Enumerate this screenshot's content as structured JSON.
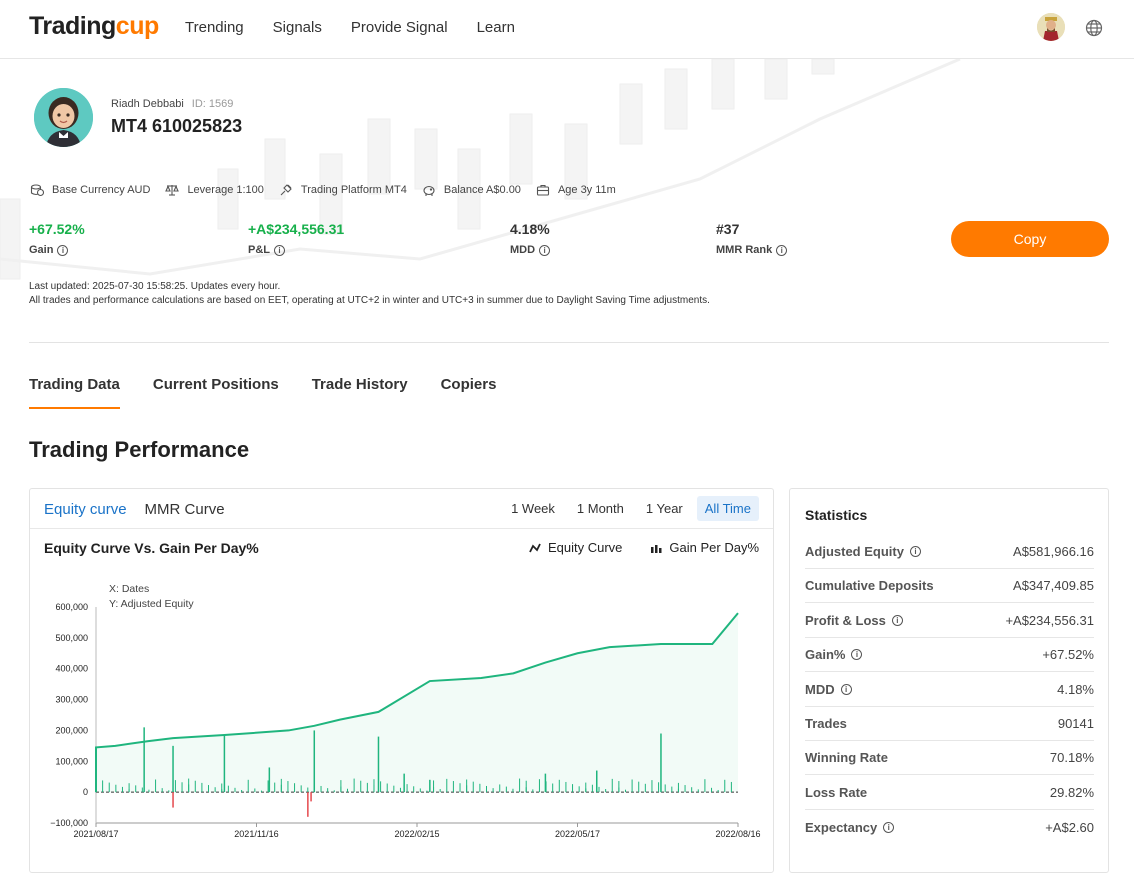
{
  "header": {
    "logo_part1": "Trading",
    "logo_part2": "cup",
    "nav": [
      "Trending",
      "Signals",
      "Provide Signal",
      "Learn"
    ]
  },
  "profile": {
    "name": "Riadh Debbabi",
    "id": "ID: 1569",
    "account": "MT4 610025823"
  },
  "meta": [
    {
      "icon": "currency-icon",
      "text": "Base Currency AUD"
    },
    {
      "icon": "scale-icon",
      "text": "Leverage 1:100"
    },
    {
      "icon": "platform-icon",
      "text": "Trading Platform MT4"
    },
    {
      "icon": "piggy-bank-icon",
      "text": "Balance A$0.00"
    },
    {
      "icon": "briefcase-icon",
      "text": "Age 3y 11m"
    }
  ],
  "kpis": {
    "gain": {
      "value": "+67.52%",
      "label": "Gain"
    },
    "pnl": {
      "value": "+A$234,556.31",
      "label": "P&L"
    },
    "mdd": {
      "value": "4.18%",
      "label": "MDD"
    },
    "rank": {
      "value": "#37",
      "label": "MMR Rank"
    }
  },
  "copy_label": "Copy",
  "notes": {
    "line1": "Last updated: 2025-07-30 15:58:25. Updates every hour.",
    "line2": "All trades and performance calculations are based on EET, operating at UTC+2 in winter and UTC+3 in summer due to Daylight Saving Time adjustments."
  },
  "tabs": [
    "Trading Data",
    "Current Positions",
    "Trade History",
    "Copiers"
  ],
  "section_title": "Trading Performance",
  "chart_card": {
    "tabs": [
      "Equity curve",
      "MMR Curve"
    ],
    "ranges": [
      "1 Week",
      "1 Month",
      "1 Year",
      "All Time"
    ],
    "title": "Equity Curve Vs. Gain Per Day%",
    "legend_equity": "Equity Curve",
    "legend_gain": "Gain Per Day%",
    "axis_note_x": "X: Dates",
    "axis_note_y": "Y: Adjusted Equity"
  },
  "chart_data": {
    "type": "line",
    "title": "Equity Curve Vs. Gain Per Day%",
    "xlabel": "Dates",
    "ylabel": "Adjusted Equity",
    "ylim": [
      -100000,
      600000
    ],
    "yticks": [
      "600,000",
      "500,000",
      "400,000",
      "300,000",
      "200,000",
      "100,000",
      "0",
      "−100,000"
    ],
    "xticks": [
      "2021/08/17",
      "2021/11/16",
      "2022/02/15",
      "2022/05/17",
      "2022/08/16"
    ],
    "series": [
      {
        "name": "Equity Curve",
        "color": "#1fb57e",
        "x": [
          0,
          0.03,
          0.08,
          0.12,
          0.2,
          0.3,
          0.34,
          0.38,
          0.44,
          0.52,
          0.6,
          0.65,
          0.7,
          0.75,
          0.8,
          0.88,
          0.96,
          1.0
        ],
        "values": [
          145000,
          150000,
          165000,
          175000,
          185000,
          200000,
          215000,
          235000,
          260000,
          360000,
          370000,
          385000,
          420000,
          450000,
          470000,
          480000,
          480000,
          580000
        ]
      },
      {
        "name": "Gain Per Day%",
        "color": "#1fb57e",
        "negative_color": "#e5484d",
        "bars": [
          {
            "x": 0.075,
            "v": 210000
          },
          {
            "x": 0.12,
            "v": 150000
          },
          {
            "x": 0.2,
            "v": 185000
          },
          {
            "x": 0.34,
            "v": 200000
          },
          {
            "x": 0.44,
            "v": 180000
          },
          {
            "x": 0.88,
            "v": 190000
          },
          {
            "x": 0.27,
            "v": 80000
          },
          {
            "x": 0.48,
            "v": 60000
          },
          {
            "x": 0.52,
            "v": 40000
          },
          {
            "x": 0.7,
            "v": 60000
          },
          {
            "x": 0.78,
            "v": 70000
          },
          {
            "x": 0.12,
            "v": -50000
          },
          {
            "x": 0.33,
            "v": -80000
          },
          {
            "x": 0.335,
            "v": -30000
          }
        ]
      }
    ]
  },
  "stats": {
    "title": "Statistics",
    "rows": [
      {
        "label": "Adjusted Equity",
        "value": "A$581,966.16",
        "info": true,
        "green": false
      },
      {
        "label": "Cumulative Deposits",
        "value": "A$347,409.85",
        "info": false,
        "green": false
      },
      {
        "label": "Profit & Loss",
        "value": "+A$234,556.31",
        "info": true,
        "green": true
      },
      {
        "label": "Gain%",
        "value": "+67.52%",
        "info": true,
        "green": true
      },
      {
        "label": "MDD",
        "value": "4.18%",
        "info": true,
        "green": false
      },
      {
        "label": "Trades",
        "value": "90141",
        "info": false,
        "green": false
      },
      {
        "label": "Winning Rate",
        "value": "70.18%",
        "info": false,
        "green": false
      },
      {
        "label": "Loss Rate",
        "value": "29.82%",
        "info": false,
        "green": false
      },
      {
        "label": "Expectancy",
        "value": "+A$2.60",
        "info": true,
        "green": true
      }
    ]
  },
  "colors": {
    "accent": "#ff7a00",
    "positive": "#17b04b",
    "link": "#1a73c8"
  }
}
